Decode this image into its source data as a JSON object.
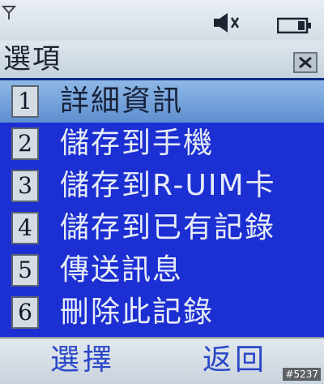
{
  "status_bar": {
    "icons": [
      "signal-antenna-icon",
      "speaker-muted-icon",
      "battery-icon"
    ]
  },
  "title_bar": {
    "title": "選項",
    "close_icon": "close-icon"
  },
  "menu": {
    "selected_index": 0,
    "items": [
      {
        "number": "1",
        "label": "詳細資訊"
      },
      {
        "number": "2",
        "label": "儲存到手機"
      },
      {
        "number": "3",
        "label": "儲存到R-UIM卡"
      },
      {
        "number": "4",
        "label": "儲存到已有記錄"
      },
      {
        "number": "5",
        "label": "傳送訊息"
      },
      {
        "number": "6",
        "label": "刪除此記錄"
      }
    ]
  },
  "softkeys": {
    "left_label": "選擇",
    "right_label": "返回"
  },
  "watermark": "#5237",
  "colors": {
    "menu_background": "#1c2fd2",
    "selected_background": "#7aa6de",
    "softkey_text": "#2a47c8",
    "title_underline": "#0b2a8a"
  }
}
